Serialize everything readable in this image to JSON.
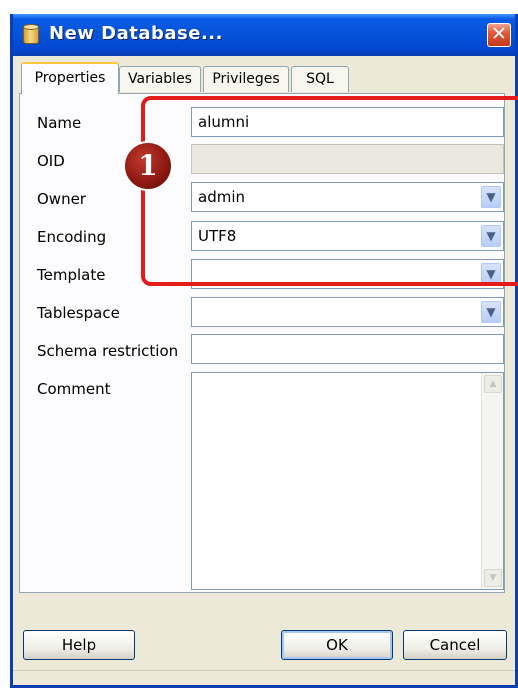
{
  "window": {
    "title": "New Database...",
    "close_glyph": "✕"
  },
  "tabs": [
    {
      "label": "Properties",
      "active": true
    },
    {
      "label": "Variables",
      "active": false
    },
    {
      "label": "Privileges",
      "active": false
    },
    {
      "label": "SQL",
      "active": false
    }
  ],
  "form": {
    "name": {
      "label": "Name",
      "value": "alumni"
    },
    "oid": {
      "label": "OID",
      "value": ""
    },
    "owner": {
      "label": "Owner",
      "value": "admin"
    },
    "encoding": {
      "label": "Encoding",
      "value": "UTF8"
    },
    "template": {
      "label": "Template",
      "value": ""
    },
    "tablespace": {
      "label": "Tablespace",
      "value": ""
    },
    "schema_restriction": {
      "label": "Schema restriction",
      "value": ""
    },
    "comment": {
      "label": "Comment",
      "value": ""
    }
  },
  "annotation": {
    "badge_number": "1",
    "color": "#E41B1B"
  },
  "buttons": {
    "help": "Help",
    "ok": "OK",
    "cancel": "Cancel"
  },
  "icons": {
    "app": "database-icon",
    "close": "close-icon",
    "dropdown": "chevron-down-icon",
    "scroll_up": "scroll-up-icon",
    "scroll_down": "scroll-down-icon"
  },
  "colors": {
    "titlebar": "#0453D8",
    "dialog_bg": "#ECE9D8",
    "tab_accent": "#FFC83C"
  }
}
